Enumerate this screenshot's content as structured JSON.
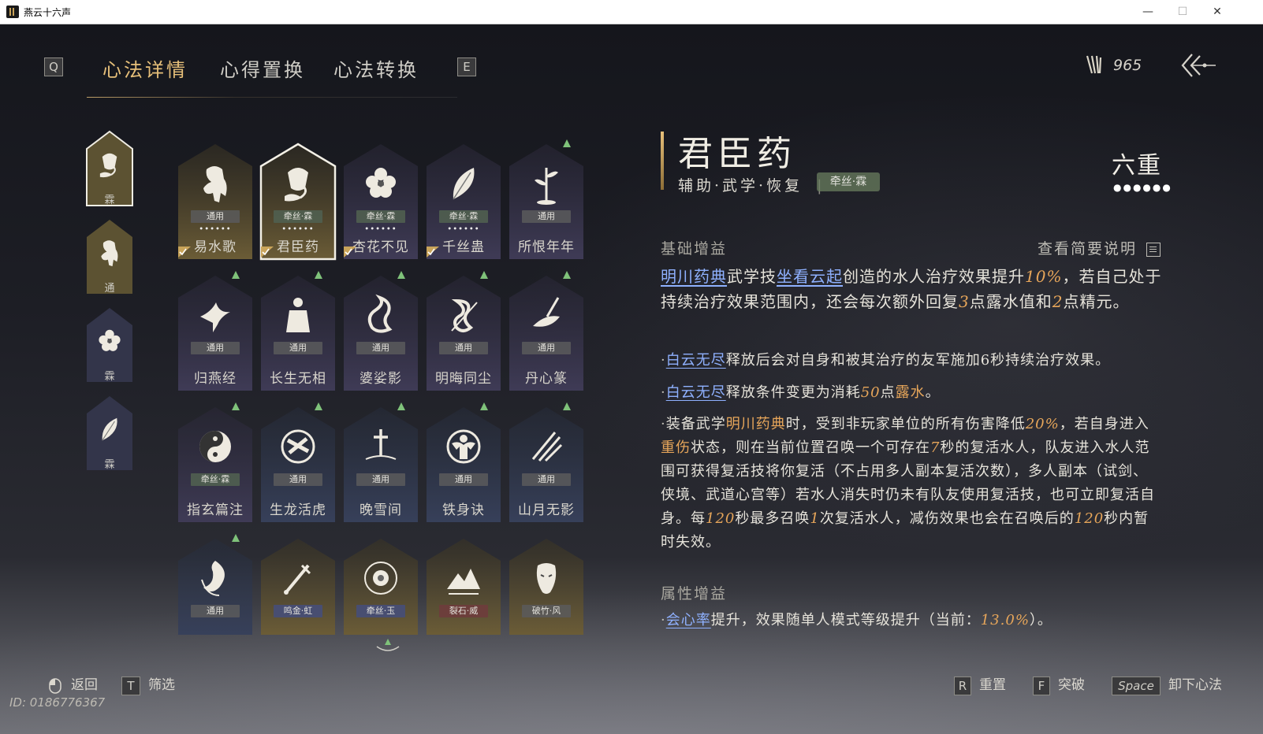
{
  "window": {
    "title": "燕云十六声",
    "minimize": "—",
    "maximize": "☐",
    "close": "✕"
  },
  "nav": {
    "key_left": "Q",
    "key_right": "E",
    "tabs": [
      {
        "label": "心法详情",
        "active": true
      },
      {
        "label": "心得置换",
        "active": false
      },
      {
        "label": "心法转换",
        "active": false
      }
    ],
    "currency_value": "965"
  },
  "side_items": [
    {
      "label": "霖",
      "icon": "pouring-vessel-icon",
      "selected": true
    },
    {
      "label": "通",
      "icon": "horse-icon",
      "selected": false
    },
    {
      "label": "霖",
      "icon": "flower-icon",
      "selected": false
    },
    {
      "label": "霖",
      "icon": "leaf-icon",
      "selected": false
    }
  ],
  "cards": [
    {
      "name": "易水歌",
      "tag": "通用",
      "tone": "gold",
      "icon": "horse-icon",
      "dots": "••••••",
      "equipped": true,
      "upgrade": false,
      "selected": false
    },
    {
      "name": "君臣药",
      "tag": "牵丝·霖",
      "tone": "gold",
      "icon": "pouring-vessel-icon",
      "dots": "••••••",
      "equipped": true,
      "upgrade": false,
      "selected": true
    },
    {
      "name": "杏花不见",
      "tag": "牵丝·霖",
      "tone": "purple",
      "icon": "flower-icon",
      "dots": "••••••",
      "equipped": true,
      "upgrade": false,
      "selected": false
    },
    {
      "name": "千丝蛊",
      "tag": "牵丝·霖",
      "tone": "purple",
      "icon": "leaf-icon",
      "dots": "••••••",
      "equipped": true,
      "upgrade": false,
      "selected": false
    },
    {
      "name": "所恨年年",
      "tag": "通用",
      "tone": "purple",
      "icon": "bamboo-icon",
      "dots": "",
      "equipped": false,
      "upgrade": true,
      "selected": false
    },
    {
      "name": "归燕经",
      "tag": "通用",
      "tone": "purple",
      "icon": "swallow-icon",
      "dots": "",
      "equipped": false,
      "upgrade": true,
      "selected": false
    },
    {
      "name": "长生无相",
      "tag": "通用",
      "tone": "purple",
      "icon": "figure-icon",
      "dots": "",
      "equipped": false,
      "upgrade": true,
      "selected": false
    },
    {
      "name": "婆娑影",
      "tag": "通用",
      "tone": "purple",
      "icon": "dragon-icon",
      "dots": "",
      "equipped": false,
      "upgrade": true,
      "selected": false
    },
    {
      "name": "明晦同尘",
      "tag": "通用",
      "tone": "purple",
      "icon": "snake-icon",
      "dots": "",
      "equipped": false,
      "upgrade": true,
      "selected": false
    },
    {
      "name": "丹心篆",
      "tag": "通用",
      "tone": "purple",
      "icon": "brush-icon",
      "dots": "",
      "equipped": false,
      "upgrade": true,
      "selected": false
    },
    {
      "name": "指玄篇注",
      "tag": "牵丝·霖",
      "tone": "purple",
      "icon": "yin-yang-icon",
      "dots": "",
      "equipped": false,
      "upgrade": true,
      "selected": false
    },
    {
      "name": "生龙活虎",
      "tag": "通用",
      "tone": "blue",
      "icon": "tiger-emblem-icon",
      "dots": "",
      "equipped": false,
      "upgrade": true,
      "selected": false
    },
    {
      "name": "晚雪间",
      "tag": "通用",
      "tone": "blue",
      "icon": "sword-in-ground-icon",
      "dots": "",
      "equipped": false,
      "upgrade": true,
      "selected": false
    },
    {
      "name": "铁身诀",
      "tag": "通用",
      "tone": "blue",
      "icon": "strongman-icon",
      "dots": "",
      "equipped": false,
      "upgrade": true,
      "selected": false
    },
    {
      "name": "山月无影",
      "tag": "通用",
      "tone": "blue",
      "icon": "slash-icon",
      "dots": "",
      "equipped": false,
      "upgrade": true,
      "selected": false
    },
    {
      "name": "",
      "tag": "通用",
      "tone": "blue",
      "icon": "koi-icon",
      "dots": "",
      "equipped": false,
      "upgrade": true,
      "selected": false
    },
    {
      "name": "",
      "tag": "鸣金·虹",
      "tone": "gold",
      "icon": "sword-icon",
      "dots": "",
      "equipped": false,
      "upgrade": false,
      "selected": false
    },
    {
      "name": "",
      "tag": "牵丝·玉",
      "tone": "gold",
      "icon": "lotus-icon",
      "dots": "",
      "equipped": false,
      "upgrade": false,
      "selected": false
    },
    {
      "name": "",
      "tag": "裂石·威",
      "tone": "gold",
      "icon": "mountain-icon",
      "dots": "",
      "equipped": false,
      "upgrade": false,
      "selected": false
    },
    {
      "name": "",
      "tag": "破竹·风",
      "tone": "gold",
      "icon": "mask-icon",
      "dots": "",
      "equipped": false,
      "upgrade": false,
      "selected": false
    }
  ],
  "detail": {
    "title": "君臣药",
    "subtitle": "辅助·武学·恢复",
    "divider": "|",
    "tag": "牵丝·霖",
    "rank": "六重",
    "rank_dots": "●●●●●●",
    "section1_title": "基础增益",
    "view_desc": "查看简要说明",
    "p1": {
      "k1": "明川药典",
      "t1": "武学技",
      "k2": "坐看云起",
      "t2": "创造的水人治疗效果提升",
      "n1": "10%",
      "t3": "，若自己处于持续治疗效果范围内，还会每次额外回复",
      "n2": "3",
      "t4": "点露水值和",
      "n3": "2",
      "t5": "点精元。"
    },
    "b1": {
      "dot": "·",
      "k": "白云无尽",
      "t": "释放后会对自身和被其治疗的友军施加6秒持续治疗效果。"
    },
    "b2": {
      "dot": "·",
      "k": "白云无尽",
      "t1": "释放条件变更为消耗",
      "n": "50",
      "t2": "点",
      "h": "露水",
      "t3": "。"
    },
    "b3": {
      "dot": "·",
      "t1": "装备武学",
      "h1": "明川药典",
      "t2": "时，受到非玩家单位的所有伤害降低",
      "n1": "20%",
      "t3": "，若自身进入",
      "h2": "重伤",
      "t4": "状态，则在当前位置召唤一个可存在",
      "n2": "7",
      "t5": "秒的复活水人，队友进入水人范围可获得复活技将你复活（不占用多人副本复活次数），多人副本（试剑、侠境、武道心宫等）若水人消失时仍未有队友使用复活技，也可立即复活自身。每",
      "n3": "120",
      "t6": "秒最多召唤",
      "n4": "1",
      "t7": "次复活水人，减伤效果也会在召唤后的",
      "n5": "120",
      "t8": "秒内暂时失效。"
    },
    "section2_title": "属性增益",
    "b4": {
      "dot": "·",
      "k": "会心率",
      "t1": "提升，效果随单人模式等级提升（当前：",
      "n": "13.0%",
      "t2": "）。"
    }
  },
  "bottom": {
    "back": "返回",
    "filter_key": "T",
    "filter": "筛选",
    "reset_key": "R",
    "reset": "重置",
    "break_key": "F",
    "break": "突破",
    "unequip_key": "Space",
    "unequip": "卸下心法",
    "uid": "ID: 0186776367"
  },
  "colors": {
    "accent_gold": "#e7c07a",
    "keyword_blue": "#8fb1ff",
    "number_orange": "#e7a65a",
    "upgrade_green": "#7fc27a"
  }
}
